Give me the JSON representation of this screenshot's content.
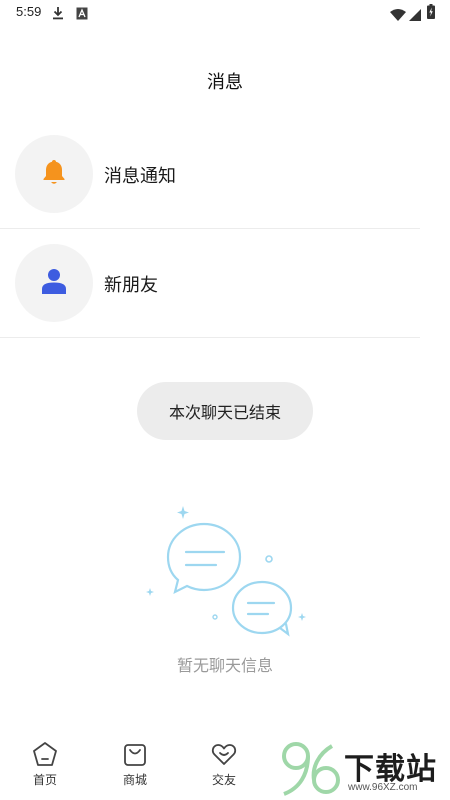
{
  "status_bar": {
    "time": "5:59",
    "icons": [
      "download-icon",
      "notification-a-icon",
      "wifi-icon",
      "cellular-signal-icon",
      "battery-charging-icon"
    ]
  },
  "header": {
    "title": "消息"
  },
  "message_rows": [
    {
      "label": "消息通知",
      "icon": "bell-icon",
      "icon_color": "#f5931d"
    },
    {
      "label": "新朋友",
      "icon": "user-icon",
      "icon_color": "#3d5ce0"
    }
  ],
  "toast": {
    "text": "本次聊天已结束"
  },
  "empty_state": {
    "text": "暂无聊天信息",
    "illustration": "chat-bubbles-icon",
    "color": "#9dd7f0"
  },
  "bottom_nav": {
    "items": [
      {
        "label": "首页",
        "icon": "home-pentagon-icon"
      },
      {
        "label": "商城",
        "icon": "shopping-bag-icon"
      },
      {
        "label": "交友",
        "icon": "heart-icon"
      }
    ]
  },
  "watermark": {
    "text": "下载站",
    "sub": "www.96XZ.com",
    "logo": "96-logo"
  }
}
